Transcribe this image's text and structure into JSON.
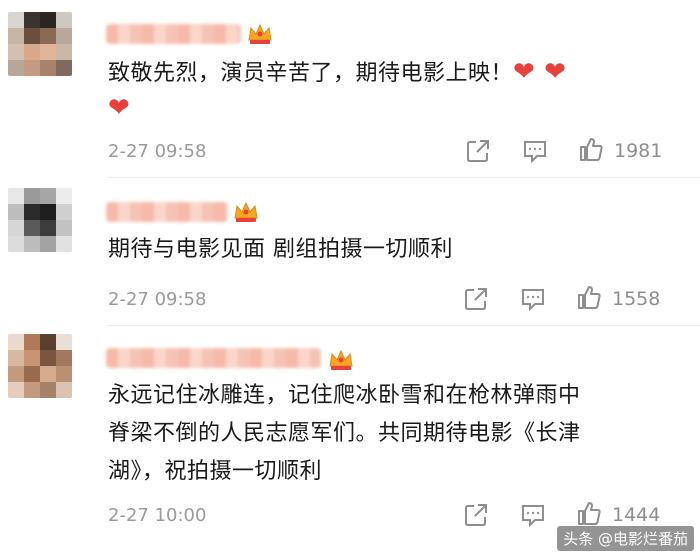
{
  "comments": [
    {
      "text_line1": "致敬先烈，演员辛苦了，期待电影上映！",
      "hearts_inline": "❤ ❤",
      "hearts_wrap": "❤",
      "time": "2-27 09:58",
      "likes": "1981"
    },
    {
      "text_line1": "期待与电影见面 剧组拍摄一切顺利",
      "time": "2-27 09:58",
      "likes": "1558"
    },
    {
      "text_line1": "永远记住冰雕连，记住爬冰卧雪和在枪林弹雨中",
      "text_line2": "脊梁不倒的人民志愿军们。共同期待电影《长津",
      "text_line3": "湖》，祝拍摄一切顺利",
      "time": "2-27 10:00",
      "likes": "1444"
    }
  ],
  "watermark": "头条 @电影烂番茄",
  "colors": {
    "heart": "#e8403a",
    "meta": "#9a9a9a",
    "crown": "#f5a623"
  },
  "icons": [
    "share-icon",
    "comment-icon",
    "like-icon",
    "crown-badge-icon"
  ]
}
